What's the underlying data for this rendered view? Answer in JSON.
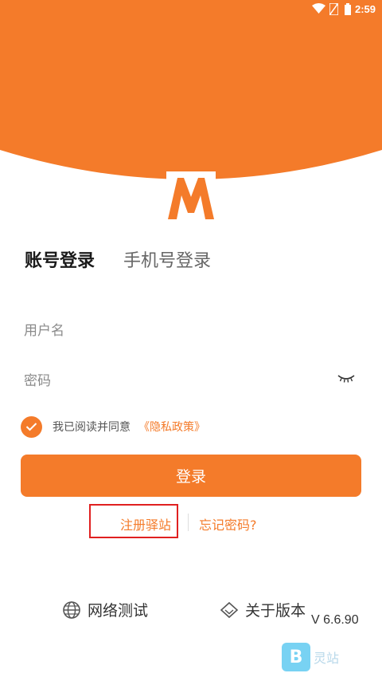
{
  "status_bar": {
    "time": "2:59"
  },
  "colors": {
    "brand": "#f47b2a",
    "highlight_box": "#e02020"
  },
  "tabs": [
    {
      "label": "账号登录",
      "active": true
    },
    {
      "label": "手机号登录",
      "active": false
    }
  ],
  "form": {
    "username_placeholder": "用户名",
    "password_placeholder": "密码"
  },
  "agreement": {
    "text": "我已阅读并同意",
    "link": "《隐私政策》",
    "checked": true
  },
  "login_button": "登录",
  "links": {
    "register": "注册驿站",
    "forgot": "忘记密码?"
  },
  "bottom": {
    "network_test": "网络测试",
    "about": "关于版本",
    "version": "V 6.6.90"
  },
  "watermark": {
    "text": "灵站"
  }
}
